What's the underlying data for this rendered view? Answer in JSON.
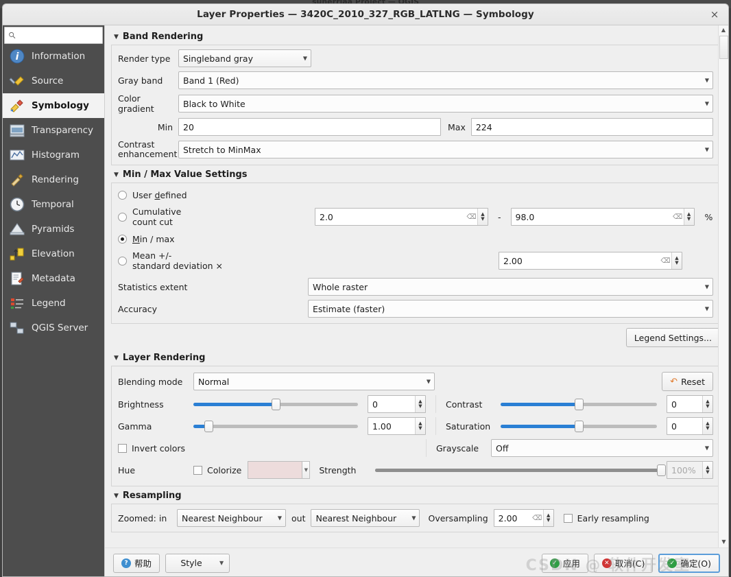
{
  "background_window_title": "sunerriaa Project — QGIS",
  "window": {
    "title": "Layer Properties — 3420C_2010_327_RGB_LATLNG — Symbology",
    "close_label": "×"
  },
  "sidebar": {
    "search_placeholder": "",
    "search_value": "",
    "items": [
      {
        "label": "Information",
        "icon": "information-icon",
        "active": false
      },
      {
        "label": "Source",
        "icon": "source-icon",
        "active": false
      },
      {
        "label": "Symbology",
        "icon": "symbology-icon",
        "active": true
      },
      {
        "label": "Transparency",
        "icon": "transparency-icon",
        "active": false
      },
      {
        "label": "Histogram",
        "icon": "histogram-icon",
        "active": false
      },
      {
        "label": "Rendering",
        "icon": "rendering-icon",
        "active": false
      },
      {
        "label": "Temporal",
        "icon": "temporal-icon",
        "active": false
      },
      {
        "label": "Pyramids",
        "icon": "pyramids-icon",
        "active": false
      },
      {
        "label": "Elevation",
        "icon": "elevation-icon",
        "active": false
      },
      {
        "label": "Metadata",
        "icon": "metadata-icon",
        "active": false
      },
      {
        "label": "Legend",
        "icon": "legend-icon",
        "active": false
      },
      {
        "label": "QGIS Server",
        "icon": "qgis-server-icon",
        "active": false
      }
    ]
  },
  "band_rendering": {
    "section_title": "Band Rendering",
    "render_type_label": "Render type",
    "render_type_value": "Singleband gray",
    "gray_band_label": "Gray band",
    "gray_band_value": "Band 1 (Red)",
    "color_gradient_label": "Color gradient",
    "color_gradient_value": "Black to White",
    "min_label": "Min",
    "min_value": "20",
    "max_label": "Max",
    "max_value": "224",
    "contrast_enhancement_label_line1": "Contrast",
    "contrast_enhancement_label_line2": "enhancement",
    "contrast_enhancement_value": "Stretch to MinMax"
  },
  "minmax": {
    "section_title": "Min / Max Value Settings",
    "user_defined_label": "User defined",
    "user_defined_selected": false,
    "cumulative_label_line1": "Cumulative",
    "cumulative_label_line2": "count cut",
    "cumulative_selected": false,
    "cumulative_low": "2.0",
    "cumulative_dash": "-",
    "cumulative_high": "98.0",
    "cumulative_unit": "%",
    "minmax_label": "Min / max",
    "minmax_selected": true,
    "mean_label_line1": "Mean +/-",
    "mean_label_line2": "standard deviation ×",
    "mean_selected": false,
    "mean_value": "2.00",
    "statistics_extent_label": "Statistics extent",
    "statistics_extent_value": "Whole raster",
    "accuracy_label": "Accuracy",
    "accuracy_value": "Estimate (faster)",
    "legend_settings_button": "Legend Settings..."
  },
  "layer_rendering": {
    "section_title": "Layer Rendering",
    "blending_mode_label": "Blending mode",
    "blending_mode_value": "Normal",
    "reset_button": "Reset",
    "brightness_label": "Brightness",
    "brightness_value": "0",
    "brightness_pct": 50,
    "contrast_label": "Contrast",
    "contrast_value": "0",
    "contrast_pct": 50,
    "gamma_label": "Gamma",
    "gamma_value": "1.00",
    "gamma_pct": 9,
    "saturation_label": "Saturation",
    "saturation_value": "0",
    "saturation_pct": 50,
    "invert_colors_label": "Invert colors",
    "invert_colors_checked": false,
    "grayscale_label": "Grayscale",
    "grayscale_value": "Off",
    "hue_label": "Hue",
    "colorize_label": "Colorize",
    "colorize_checked": false,
    "colorize_color": "#eddcdc",
    "strength_label": "Strength",
    "strength_value": "100%",
    "strength_pct": 100
  },
  "resampling": {
    "section_title": "Resampling",
    "zoomed_in_label": "Zoomed: in",
    "zoomed_in_value": "Nearest Neighbour",
    "zoomed_out_label": "out",
    "zoomed_out_value": "Nearest Neighbour",
    "oversampling_label": "Oversampling",
    "oversampling_value": "2.00",
    "early_resampling_label": "Early resampling",
    "early_resampling_checked": false
  },
  "footer": {
    "help_button": "帮助",
    "style_button": "Style",
    "apply_button": "应用",
    "cancel_button": "取消(C)",
    "ok_button": "确定(O)",
    "watermark": "CSDN @ 软件开发室"
  },
  "colors": {
    "accent_blue": "#2a7fd4",
    "sidebar_bg": "#4d4d4d",
    "panel_bg": "#efefef"
  }
}
